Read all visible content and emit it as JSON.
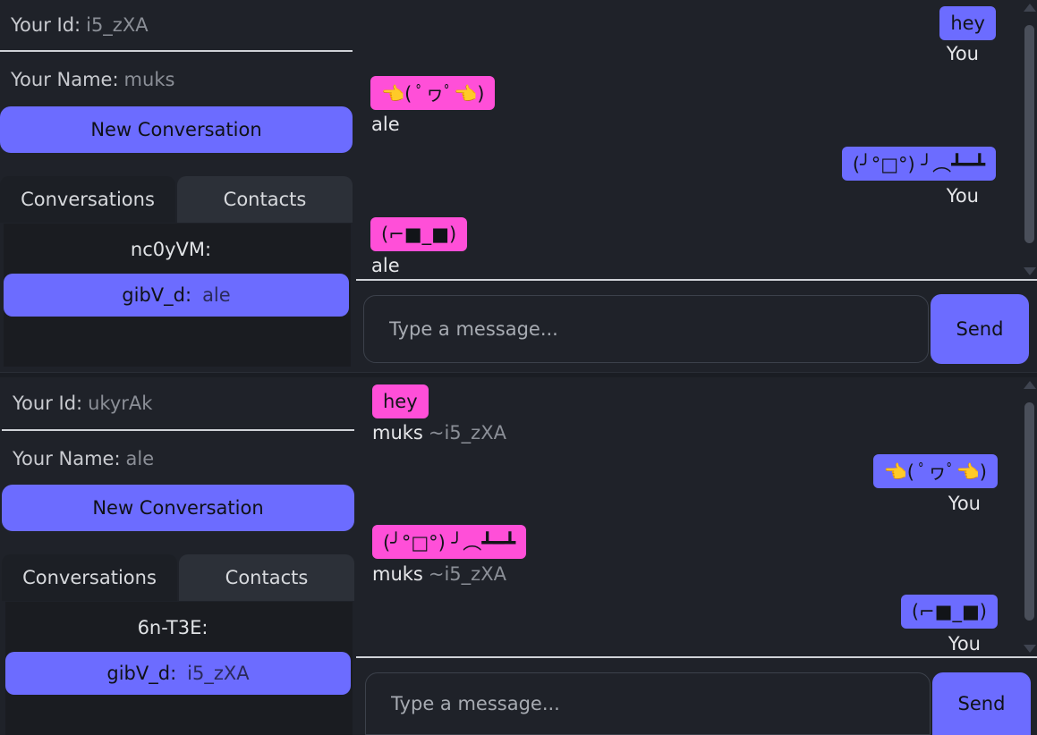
{
  "panels": [
    {
      "id_label": "Your Id:",
      "id_value": "i5_zXA",
      "name_label": "Your Name:",
      "name_value": "muks",
      "new_conversation": "New Conversation",
      "tabs": {
        "conversations": "Conversations",
        "contacts": "Contacts"
      },
      "conversations": [
        {
          "id": "nc0yVM:",
          "last": ""
        },
        {
          "id": "gibV_d:",
          "last": "ale"
        }
      ],
      "messages": [
        {
          "text": "hey",
          "sender": "You",
          "sender_id": ""
        },
        {
          "text": "👈( ﾟヮﾟ👈)",
          "sender": "ale",
          "sender_id": ""
        },
        {
          "text": "(╯°□°) ╯︵┻━┻",
          "sender": "You",
          "sender_id": ""
        },
        {
          "text": "(⌐■_■)",
          "sender": "ale",
          "sender_id": ""
        }
      ],
      "input_placeholder": "Type a message...",
      "send_label": "Send"
    },
    {
      "id_label": "Your Id:",
      "id_value": "ukyrAk",
      "name_label": "Your Name:",
      "name_value": "ale",
      "new_conversation": "New Conversation",
      "tabs": {
        "conversations": "Conversations",
        "contacts": "Contacts"
      },
      "conversations": [
        {
          "id": "6n-T3E:",
          "last": ""
        },
        {
          "id": "gibV_d:",
          "last": "i5_zXA"
        }
      ],
      "messages": [
        {
          "text": "hey",
          "sender": "muks",
          "sender_id": "~i5_zXA"
        },
        {
          "text": "👈( ﾟヮﾟ👈)",
          "sender": "You",
          "sender_id": ""
        },
        {
          "text": "(╯°□°) ╯︵┻━┻",
          "sender": "muks",
          "sender_id": "~i5_zXA"
        },
        {
          "text": "(⌐■_■)",
          "sender": "You",
          "sender_id": ""
        }
      ],
      "input_placeholder": "Type a message...",
      "send_label": "Send"
    }
  ],
  "colors": {
    "accent": "#6c6cff",
    "incoming": "#ff4fd8",
    "background": "#1f2229"
  }
}
